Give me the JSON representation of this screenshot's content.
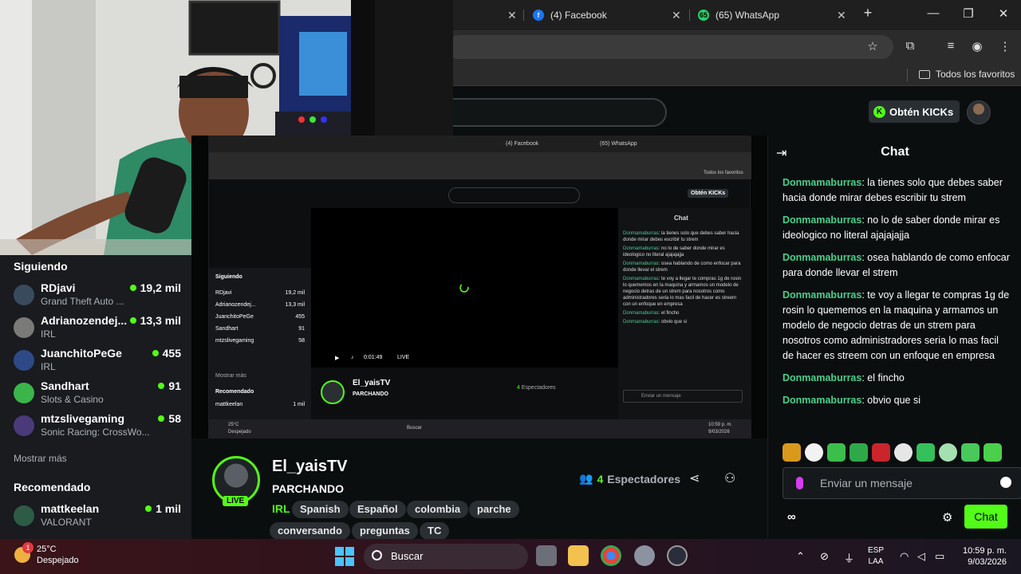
{
  "browser": {
    "tabs": [
      {
        "label": "(4) Facebook",
        "favicon": "facebook-icon",
        "color": "#1877f2"
      },
      {
        "label": "(65) WhatsApp",
        "favicon": "whatsapp-icon",
        "color": "#25d366"
      }
    ],
    "new_tab": "+",
    "bookmarks": {
      "all_favorites": "Todos los favoritos"
    }
  },
  "header": {
    "kicks_button": "Obtén KICKs",
    "coin_letter": "K",
    "accent": "#53fc18"
  },
  "sidebar": {
    "following_heading": "Siguiendo",
    "following": [
      {
        "name": "RDjavi",
        "game": "Grand Theft Auto ...",
        "viewers": "19,2 mil"
      },
      {
        "name": "Adrianozendej...",
        "game": "IRL",
        "viewers": "13,3 mil"
      },
      {
        "name": "JuanchitoPeGe",
        "game": "IRL",
        "viewers": "455"
      },
      {
        "name": "Sandhart",
        "game": "Slots & Casino",
        "viewers": "91"
      },
      {
        "name": "mtzslivegaming",
        "game": "Sonic Racing: CrossWo...",
        "viewers": "58"
      }
    ],
    "show_more": "Mostrar más",
    "recommended_heading": "Recomendado",
    "recommended": [
      {
        "name": "mattkeelan",
        "game": "VALORANT",
        "viewers": "1 mil"
      }
    ]
  },
  "video": {
    "nested_time": "0:01:49",
    "nested_live": "LIVE",
    "nested_chat_title": "Chat",
    "nested_input": "Enviar un mensaje",
    "nested_search": "Buscar"
  },
  "stream": {
    "streamer": "El_yaisTV",
    "live_badge": "LIVE",
    "title": "PARCHANDO",
    "category": "IRL",
    "tags": [
      "Spanish",
      "Español",
      "colombia",
      "parche",
      "conversando",
      "preguntas",
      "TC"
    ],
    "viewer_count": "4",
    "viewer_label": "Espectadores"
  },
  "chat": {
    "title": "Chat",
    "messages": [
      {
        "user": "Donmamaburras",
        "text": "la tienes solo que debes saber hacia donde mirar debes escribir tu strem"
      },
      {
        "user": "Donmamaburras",
        "text": "no lo de saber donde mirar es ideologico no literal ajajajajja"
      },
      {
        "user": "Donmamaburras",
        "text": "osea hablando de como enfocar para donde llevar el strem"
      },
      {
        "user": "Donmamaburras",
        "text": "te voy a llegar te compras 1g de rosin lo quememos en la maquina y armamos un modelo de negocio detras de un strem para nosotros como administradores seria lo mas facil de hacer es streem con un enfoque en empresa"
      },
      {
        "user": "Donmamaburras",
        "text": "el fincho"
      },
      {
        "user": "Donmamaburras",
        "text": "obvio que si"
      }
    ],
    "input_placeholder": "Enviar un mensaje",
    "infinity": "∞",
    "send_label": "Chat"
  },
  "taskbar": {
    "temperature": "25°C",
    "weather": "Despejado",
    "weather_badge": "1",
    "search_label": "Buscar",
    "language_top": "ESP",
    "language_bottom": "LAA",
    "time": "10:59 p. m.",
    "date": "9/03/2026"
  }
}
